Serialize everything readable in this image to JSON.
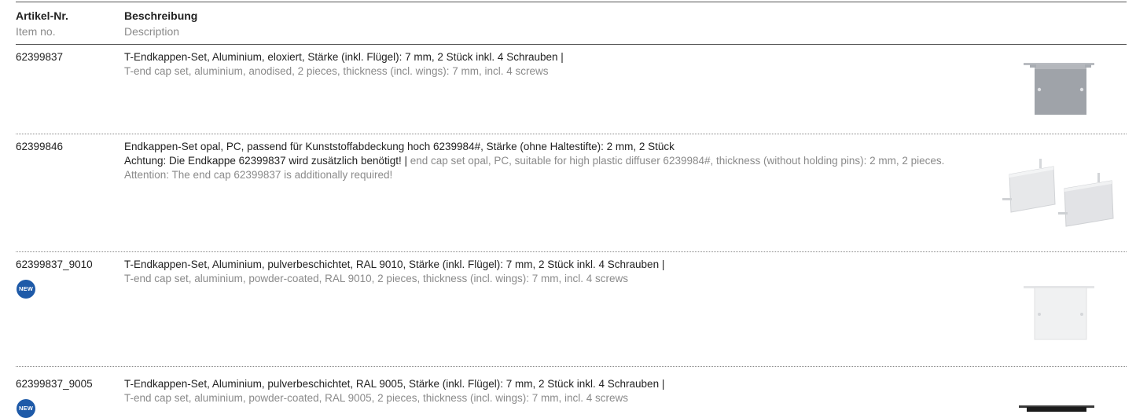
{
  "header": {
    "col1_de": "Artikel-Nr.",
    "col1_en": "Item no.",
    "col2_de": "Beschreibung",
    "col2_en": "Description"
  },
  "badge_label": "NEW",
  "colors": {
    "badge": "#1e5aa8",
    "secondary_text": "#8a8a8a",
    "primary_text": "#222222"
  },
  "rows": [
    {
      "item_no": "62399837",
      "desc_de": "T-Endkappen-Set, Aluminium, eloxiert, Stärke (inkl. Flügel): 7 mm, 2 Stück inkl. 4 Schrauben |",
      "desc_en": "T-end cap set, aluminium, anodised, 2 pieces, thickness (incl. wings): 7 mm, incl. 4 screws",
      "image": "grey-t-end-cap"
    },
    {
      "item_no": "62399846",
      "desc_de": "Endkappen-Set opal, PC, passend für Kunststoffabdeckung hoch 6239984#, Stärke (ohne Haltestifte): 2 mm, 2 Stück",
      "desc_de_note": "Achtung: Die Endkappe 62399837 wird zusätzlich benötigt!",
      "separator": " | ",
      "desc_en": "end cap set opal, PC, suitable for high plastic diffuser 6239984#, thickness (without holding pins): 2 mm, 2 pieces.  Attention: The end cap 62399837 is additionally required!",
      "image": "two-opal-end-caps"
    },
    {
      "item_no": "62399837_9010",
      "badge": "NEW",
      "desc_de": "T-Endkappen-Set, Aluminium, pulverbeschichtet, RAL 9010, Stärke (inkl. Flügel): 7 mm, 2 Stück inkl. 4 Schrauben |",
      "desc_en": "T-end cap set, aluminium, powder-coated, RAL 9010, 2 pieces, thickness (incl. wings): 7 mm, incl. 4 screws",
      "image": "white-t-end-cap"
    },
    {
      "item_no": "62399837_9005",
      "badge": "NEW",
      "desc_de": "T-Endkappen-Set, Aluminium, pulverbeschichtet, RAL 9005, Stärke (inkl. Flügel): 7 mm, 2 Stück inkl. 4 Schrauben |",
      "desc_en": "T-end cap set, aluminium, powder-coated, RAL 9005, 2 pieces, thickness (incl. wings): 7 mm, incl. 4 screws",
      "image": "black-t-end-cap"
    }
  ]
}
